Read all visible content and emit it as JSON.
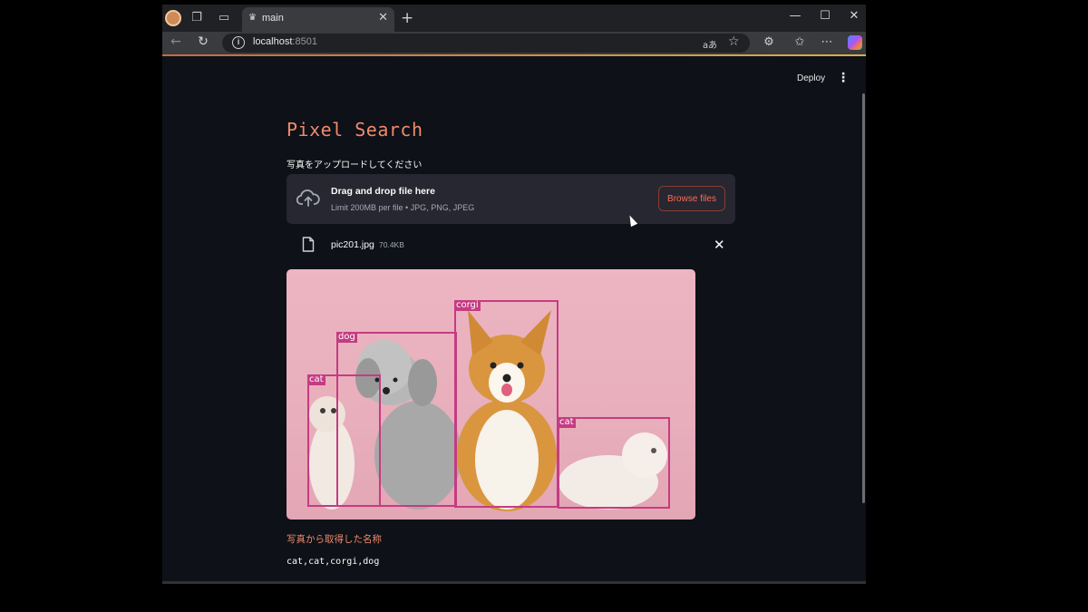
{
  "browser": {
    "tab_title": "main",
    "url_host": "localhost",
    "url_port": ":8501",
    "read_aloud_glyph": "aあ"
  },
  "app": {
    "deploy_label": "Deploy",
    "title": "Pixel Search",
    "upload_label": "写真をアップロードしてください",
    "dropzone": {
      "title": "Drag and drop file here",
      "limit": "Limit 200MB per file • JPG, PNG, JPEG",
      "browse_label": "Browse files"
    },
    "uploaded_file": {
      "name": "pic201.jpg",
      "size": "70.4KB"
    },
    "detections": [
      {
        "label": "cat"
      },
      {
        "label": "dog"
      },
      {
        "label": "corgi"
      },
      {
        "label": "cat"
      }
    ],
    "result_heading": "写真から取得した名称",
    "result_names": "cat,cat,corgi,dog"
  },
  "colors": {
    "accent": "#f08a6c",
    "box": "#c43c83",
    "background": "#0e1117",
    "dropzone": "#262730"
  }
}
